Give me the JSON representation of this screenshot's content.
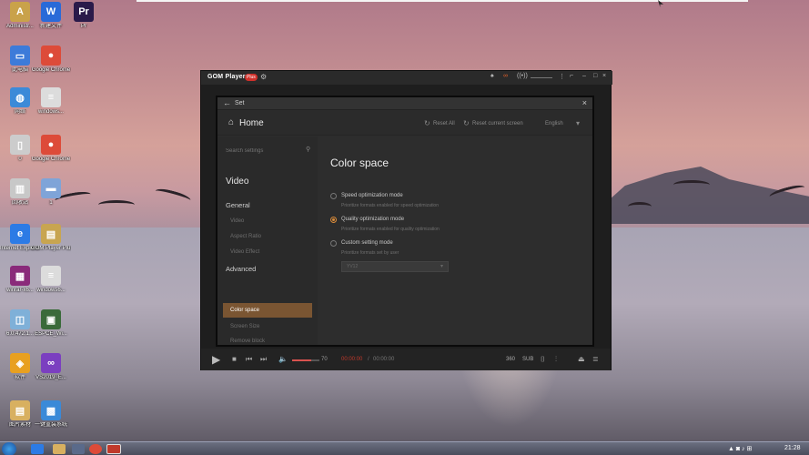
{
  "desktop": {
    "icons": [
      {
        "label": "Administr...",
        "color": "#c9a24a",
        "glyph": "A"
      },
      {
        "label": "新建文件",
        "color": "#2a6ad8",
        "glyph": "W"
      },
      {
        "label": "Pr",
        "color": "#2a1a4a",
        "glyph": "Pr"
      },
      {
        "label": "此电脑",
        "color": "#3d7bd9",
        "glyph": "▭"
      },
      {
        "label": "Google Chrome",
        "color": "#dd4b39",
        "glyph": "●"
      },
      {
        "label": "网络",
        "color": "#3c8ad8",
        "glyph": "◍"
      },
      {
        "label": "windows...",
        "color": "#dcdcdc",
        "glyph": "≡"
      },
      {
        "label": "0",
        "color": "#cccccc",
        "glyph": "▯"
      },
      {
        "label": "Google Chrome",
        "color": "#dd4b39",
        "glyph": "●"
      },
      {
        "label": "回收站",
        "color": "#c8c8c8",
        "glyph": "▥"
      },
      {
        "label": "1",
        "color": "#7fa4d8",
        "glyph": "▬"
      },
      {
        "label": "Internet Explorer",
        "color": "#2c7be5",
        "glyph": "e"
      },
      {
        "label": "GOM Player Plus V2.3.5...",
        "color": "#c8a550",
        "glyph": "▤"
      },
      {
        "label": "winrar-x6...",
        "color": "#8a2a7a",
        "glyph": "▦"
      },
      {
        "label": "windows6...",
        "color": "#dcdcdc",
        "glyph": "≡"
      },
      {
        "label": "6.0.472.1...",
        "color": "#7fb0d8",
        "glyph": "◫"
      },
      {
        "label": "ESPCE_Wi...",
        "color": "#3a6a3a",
        "glyph": "▣"
      },
      {
        "label": "软件",
        "color": "#e8a020",
        "glyph": "◈"
      },
      {
        "label": "VS2019_E...",
        "color": "#7b3fc0",
        "glyph": "∞"
      },
      {
        "label": "图片素材",
        "color": "#d8b060",
        "glyph": "▤"
      },
      {
        "label": "一键重装系统",
        "color": "#3a8ad8",
        "glyph": "▩"
      }
    ]
  },
  "gom": {
    "logo": "GOM Player",
    "plus": "Plus",
    "settings": {
      "title": "Set",
      "home": "Home",
      "reset_all": "Reset All",
      "reset_screen": "Reset current screen",
      "language": "English",
      "search_placeholder": "Search settings",
      "sidebar": {
        "section": "Video",
        "general": "General",
        "general_items": [
          "Video",
          "Aspect Ratio",
          "Video Effect"
        ],
        "advanced": "Advanced",
        "advanced_items": [
          "Color space",
          "Screen Size",
          "Remove block"
        ],
        "active": "Color space"
      },
      "content": {
        "title": "Color space",
        "options": [
          {
            "label": "Speed optimization mode",
            "desc": "Prioritize formats enabled for speed optimization",
            "selected": false
          },
          {
            "label": "Quality optimization mode",
            "desc": "Prioritize formats enabled for quality optimization",
            "selected": true
          },
          {
            "label": "Custom setting mode",
            "desc": "Prioritize formats set by user",
            "selected": false
          }
        ],
        "dropdown_value": "YV12"
      }
    },
    "controls": {
      "volume": "70",
      "volume_fraction": 0.7,
      "time_current": "00:00:00",
      "time_sep": "/",
      "time_total": "00:00:00",
      "deg": "360",
      "sub": "SUB"
    }
  },
  "taskbar": {
    "time": "21:28"
  }
}
